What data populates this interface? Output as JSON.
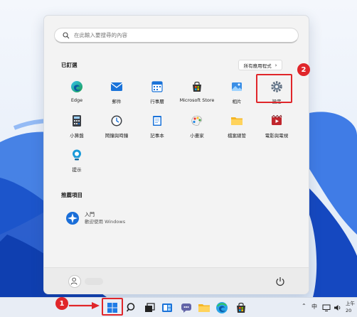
{
  "start_menu": {
    "search_placeholder": "在此輸入要搜尋的內容",
    "pinned_title": "已釘選",
    "all_apps_label": "所有應用程式",
    "pinned_apps": [
      {
        "label": "Edge",
        "icon": "edge-icon"
      },
      {
        "label": "郵件",
        "icon": "mail-icon"
      },
      {
        "label": "行事曆",
        "icon": "calendar-icon"
      },
      {
        "label": "Microsoft Store",
        "icon": "store-icon"
      },
      {
        "label": "相片",
        "icon": "photos-icon"
      },
      {
        "label": "設定",
        "icon": "settings-gear-icon"
      },
      {
        "label": "小算盤",
        "icon": "calculator-icon"
      },
      {
        "label": "鬧鐘與時鐘",
        "icon": "clock-icon"
      },
      {
        "label": "記事本",
        "icon": "notepad-icon"
      },
      {
        "label": "小畫家",
        "icon": "paint-icon"
      },
      {
        "label": "檔案總管",
        "icon": "folder-icon"
      },
      {
        "label": "電影與電視",
        "icon": "movies-icon"
      },
      {
        "label": "提示",
        "icon": "tips-icon"
      }
    ],
    "recommended_title": "推薦項目",
    "recommended": [
      {
        "title": "入門",
        "subtitle": "歡迎使用 Windows",
        "icon": "get-started-icon"
      }
    ]
  },
  "annotations": {
    "step1": "1",
    "step2": "2",
    "highlight_color": "#e0262a"
  },
  "taskbar": {
    "tray_ime": "中",
    "clock_line1": "上午",
    "clock_line2": "20"
  }
}
